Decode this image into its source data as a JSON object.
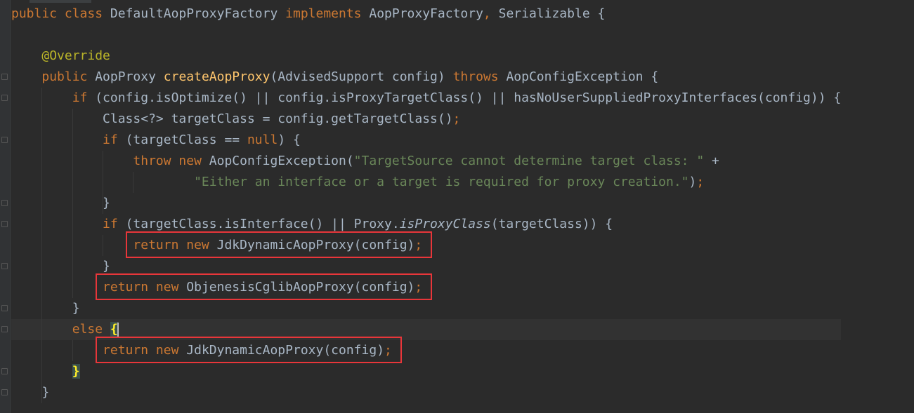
{
  "editor": {
    "lines": [
      {
        "tokens": [
          {
            "t": "public ",
            "c": "kw"
          },
          {
            "t": "class ",
            "c": "kw"
          },
          {
            "t": "DefaultAopProxyFactory ",
            "c": "df"
          },
          {
            "t": "implements ",
            "c": "kw"
          },
          {
            "t": "AopProxyFactory",
            "c": "df"
          },
          {
            "t": ", ",
            "c": "kw"
          },
          {
            "t": "Serializable {",
            "c": "df"
          }
        ]
      },
      {
        "tokens": []
      },
      {
        "tokens": [
          {
            "t": "    ",
            "c": "df"
          },
          {
            "t": "@Override",
            "c": "an"
          }
        ]
      },
      {
        "tokens": [
          {
            "t": "    ",
            "c": "df"
          },
          {
            "t": "public ",
            "c": "kw"
          },
          {
            "t": "AopProxy ",
            "c": "df"
          },
          {
            "t": "createAopProxy",
            "c": "fn"
          },
          {
            "t": "(AdvisedSupport config) ",
            "c": "df"
          },
          {
            "t": "throws ",
            "c": "kw"
          },
          {
            "t": "AopConfigException {",
            "c": "df"
          }
        ]
      },
      {
        "tokens": [
          {
            "t": "        ",
            "c": "df"
          },
          {
            "t": "if ",
            "c": "kw"
          },
          {
            "t": "(config.isOptimize() || config.isProxyTargetClass() || hasNoUserSuppliedProxyInterfaces(config)) {",
            "c": "df"
          }
        ]
      },
      {
        "tokens": [
          {
            "t": "            Class<?> targetClass = config.getTargetClass()",
            "c": "df"
          },
          {
            "t": ";",
            "c": "kw"
          }
        ]
      },
      {
        "tokens": [
          {
            "t": "            ",
            "c": "df"
          },
          {
            "t": "if ",
            "c": "kw"
          },
          {
            "t": "(targetClass == ",
            "c": "df"
          },
          {
            "t": "null",
            "c": "kw"
          },
          {
            "t": ") {",
            "c": "df"
          }
        ]
      },
      {
        "tokens": [
          {
            "t": "                ",
            "c": "df"
          },
          {
            "t": "throw new ",
            "c": "kw"
          },
          {
            "t": "AopConfigException(",
            "c": "df"
          },
          {
            "t": "\"TargetSource cannot determine target class: \" ",
            "c": "str"
          },
          {
            "t": "+",
            "c": "df"
          }
        ]
      },
      {
        "tokens": [
          {
            "t": "                        ",
            "c": "df"
          },
          {
            "t": "\"Either an interface or a target is required for proxy creation.\"",
            "c": "str"
          },
          {
            "t": ")",
            "c": "df"
          },
          {
            "t": ";",
            "c": "kw"
          }
        ]
      },
      {
        "tokens": [
          {
            "t": "            }",
            "c": "df"
          }
        ]
      },
      {
        "tokens": [
          {
            "t": "            ",
            "c": "df"
          },
          {
            "t": "if ",
            "c": "kw"
          },
          {
            "t": "(targetClass.isInterface() || Proxy.",
            "c": "df"
          },
          {
            "t": "isProxyClass",
            "c": "it"
          },
          {
            "t": "(targetClass)) {",
            "c": "df"
          }
        ]
      },
      {
        "tokens": [
          {
            "t": "                ",
            "c": "df"
          },
          {
            "t": "return new ",
            "c": "kw"
          },
          {
            "t": "JdkDynamicAopProxy(config)",
            "c": "df"
          },
          {
            "t": ";",
            "c": "kw"
          }
        ]
      },
      {
        "tokens": [
          {
            "t": "            }",
            "c": "df"
          }
        ]
      },
      {
        "tokens": [
          {
            "t": "            ",
            "c": "df"
          },
          {
            "t": "return new ",
            "c": "kw"
          },
          {
            "t": "ObjenesisCglibAopProxy(config)",
            "c": "df"
          },
          {
            "t": ";",
            "c": "kw"
          }
        ]
      },
      {
        "tokens": [
          {
            "t": "        }",
            "c": "df"
          }
        ]
      },
      {
        "current": true,
        "tokens": [
          {
            "t": "        ",
            "c": "df"
          },
          {
            "t": "else ",
            "c": "kw"
          },
          {
            "t": "{",
            "c": "brace-hl"
          },
          {
            "t": "",
            "c": "caret"
          }
        ]
      },
      {
        "tokens": [
          {
            "t": "            ",
            "c": "df"
          },
          {
            "t": "return new ",
            "c": "kw"
          },
          {
            "t": "JdkDynamicAopProxy(config)",
            "c": "df"
          },
          {
            "t": ";",
            "c": "kw"
          }
        ]
      },
      {
        "tokens": [
          {
            "t": "        ",
            "c": "df"
          },
          {
            "t": "}",
            "c": "brace-hl"
          }
        ]
      },
      {
        "tokens": [
          {
            "t": "    }",
            "c": "df"
          }
        ]
      }
    ]
  },
  "highlights": {
    "color": "#e8363a",
    "boxes": [
      {
        "label": "return new JdkDynamicAopProxy(config);"
      },
      {
        "label": "return new ObjenesisCglibAopProxy(config);"
      },
      {
        "label": "return new JdkDynamicAopProxy(config);"
      }
    ]
  },
  "theme": {
    "background": "#2b2b2b",
    "keyword": "#cc7832",
    "annotation": "#bbb529",
    "method_decl": "#ffc66d",
    "string": "#6a8759",
    "default": "#a9b7c6"
  }
}
